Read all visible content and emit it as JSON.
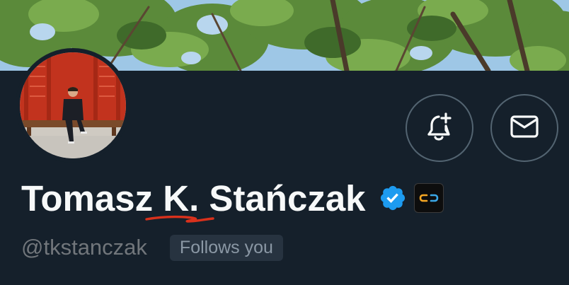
{
  "profile": {
    "display_name": "Tomasz K. Stańczak",
    "handle": "@tkstanczak",
    "follows_badge": "Follows you",
    "verified": true
  },
  "icons": {
    "notify": "bell-plus-icon",
    "message": "envelope-icon",
    "verified": "verified-badge-icon",
    "affiliate": "affiliate-logo-icon"
  },
  "colors": {
    "background": "#15202b",
    "verified_blue": "#1d9bf0",
    "button_border": "#536471",
    "handle_gray": "#71767b",
    "annotation_red": "#d9311c"
  }
}
